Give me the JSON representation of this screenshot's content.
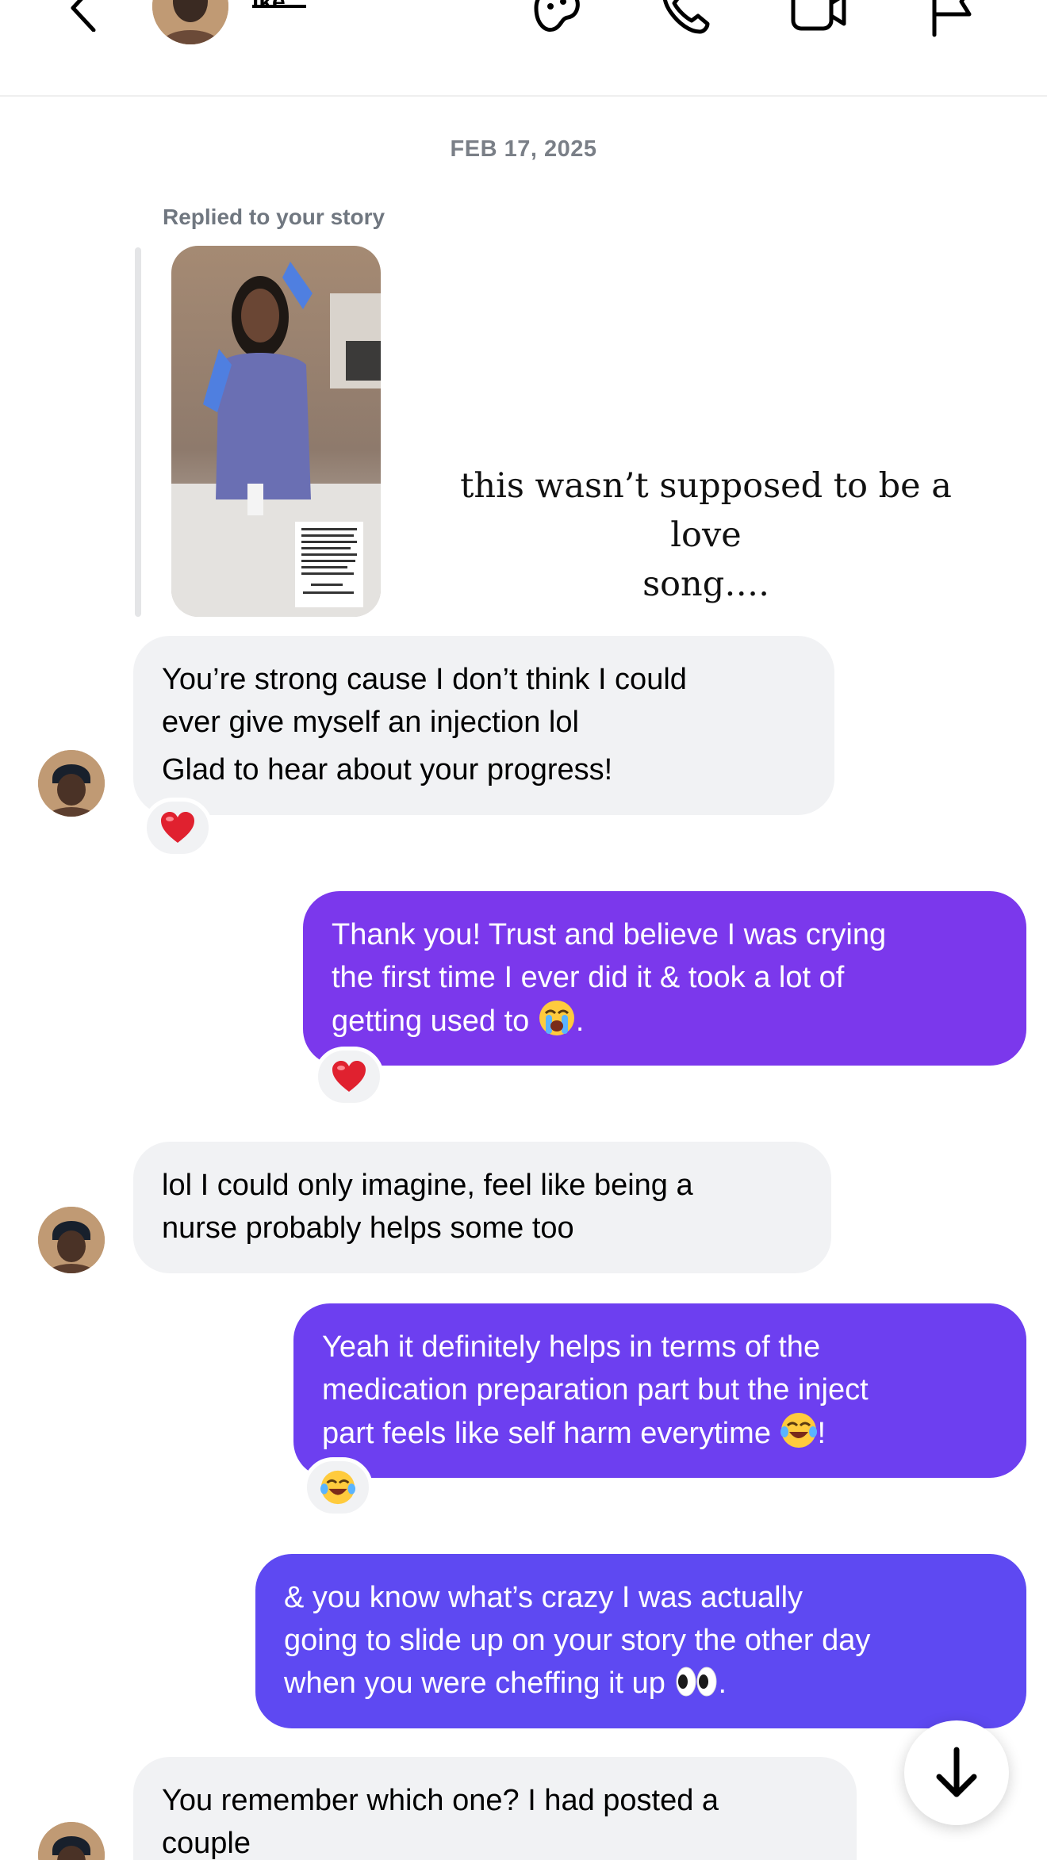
{
  "header": {
    "username": "ike",
    "icons": [
      "back-chevron-icon",
      "avatar-effects-icon",
      "phone-icon",
      "video-icon",
      "flag-icon"
    ]
  },
  "thread": {
    "date": "FEB 17, 2025",
    "story_reply": {
      "caption": "Replied to your story",
      "story_text_line1": "this wasn’t supposed to be a love",
      "story_text_line2": "song…."
    },
    "messages": [
      {
        "sender": "them",
        "lines": [
          "You’re strong cause I don’t think I could",
          "ever give myself an injection lol",
          "Glad to hear about your progress!"
        ],
        "reaction": "heart"
      },
      {
        "sender": "me",
        "lines": [
          "Thank you! Trust and believe I was crying",
          "the first time I ever did it & took a lot of",
          "getting used to ",
          "."
        ],
        "inline_emoji": "loudly-crying-face",
        "reaction": "heart"
      },
      {
        "sender": "them",
        "lines": [
          "lol I could only imagine, feel like being a",
          "nurse probably helps some too"
        ]
      },
      {
        "sender": "me",
        "lines": [
          "Yeah it definitely helps in terms of the",
          "medication preparation part but the inject",
          "part feels like self harm everytime ",
          "!"
        ],
        "inline_emoji": "tears-of-joy",
        "reaction": "tears-of-joy"
      },
      {
        "sender": "me",
        "lines": [
          "& you know what’s crazy I was actually",
          "going to slide up on your story the other day",
          "when you were cheffing it up ",
          "."
        ],
        "inline_emoji": "eyes"
      },
      {
        "sender": "them",
        "lines": [
          "You remember which one? I had posted a",
          "couple"
        ]
      }
    ]
  },
  "colors": {
    "incoming_bubble": "#f1f2f4",
    "outgoing_1": "#7b38ec",
    "outgoing_2": "#6d3ff0",
    "outgoing_3": "#5e49f2",
    "date_text": "#7a7f87"
  }
}
